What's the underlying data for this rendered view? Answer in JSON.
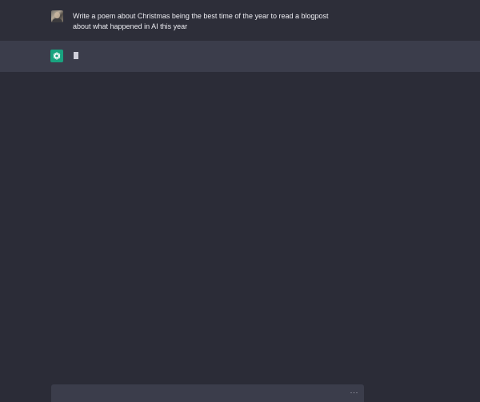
{
  "conversation": {
    "user_message": "Write a poem about Christmas being the best time of the year to read a blogpost about what happened in AI this year",
    "assistant_message": "",
    "assistant_state": "typing"
  },
  "input": {
    "status_indicator": "···"
  },
  "icons": {
    "user_avatar": "user-avatar",
    "assistant_avatar": "openai-logo-icon"
  },
  "colors": {
    "assistant_accent": "#19a37f",
    "background": "#2b2c37",
    "assistant_row": "#3b3d4b"
  }
}
